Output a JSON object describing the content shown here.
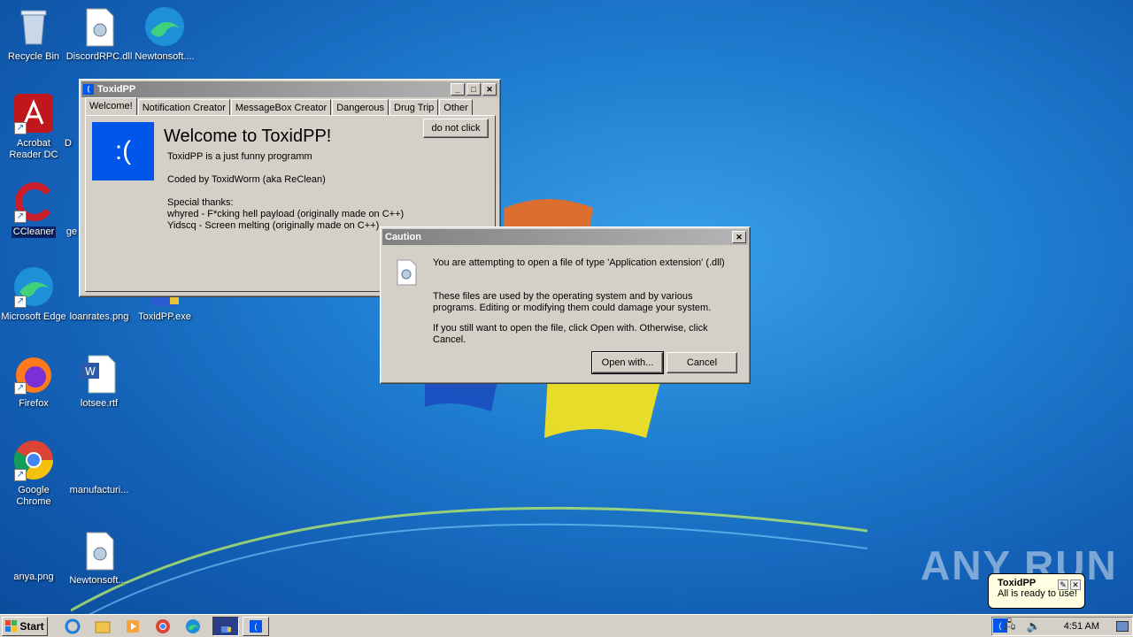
{
  "desktop": {
    "icons": [
      {
        "label": "Recycle Bin"
      },
      {
        "label": "DiscordRPC.dll"
      },
      {
        "label": "Newtonsoft...."
      },
      {
        "label": "Acrobat Reader DC"
      },
      {
        "label": "D"
      },
      {
        "label": "CCleaner"
      },
      {
        "label": "ge"
      },
      {
        "label": "Microsoft Edge"
      },
      {
        "label": "loanrates.png"
      },
      {
        "label": "ToxidPP.exe"
      },
      {
        "label": "Firefox"
      },
      {
        "label": "lotsee.rtf"
      },
      {
        "label": "Google Chrome"
      },
      {
        "label": "manufacturi..."
      },
      {
        "label": "anya.png"
      },
      {
        "label": "Newtonsoft...."
      }
    ],
    "watermark": "ANY RUN"
  },
  "toxid_window": {
    "title": "ToxidPP",
    "tabs": [
      "Welcome!",
      "Notification Creator",
      "MessageBox Creator",
      "Dangerous",
      "Drug Trip",
      "Other"
    ],
    "active_tab": "Welcome!",
    "bsod_face": ":(",
    "heading": "Welcome to ToxidPP!",
    "line1": "ToxidPP is a just funny programm",
    "line2": "Coded by ToxidWorm (aka ReClean)",
    "thanks_title": "Special thanks:",
    "thanks1": "whyred - F*cking hell payload (originally made on C++)",
    "thanks2": "Yidscq - Screen melting (originally made on C++)",
    "do_not_click": "do not click"
  },
  "caution_dialog": {
    "title": "Caution",
    "line1": "You are attempting to open a file of type 'Application extension' (.dll)",
    "line2": "These files are used by the operating system and by various programs. Editing or modifying them could damage your system.",
    "line3": "If you still want to open the file, click Open with. Otherwise, click Cancel.",
    "open_with": "Open with...",
    "cancel": "Cancel"
  },
  "taskbar": {
    "start": "Start",
    "clock": "4:51 AM"
  },
  "balloon": {
    "title": "ToxidPP",
    "message": "All is ready to use!"
  },
  "colors": {
    "bsod_blue": "#0055ea",
    "window_face": "#d4d0c8",
    "title_inactive": "#808080"
  }
}
